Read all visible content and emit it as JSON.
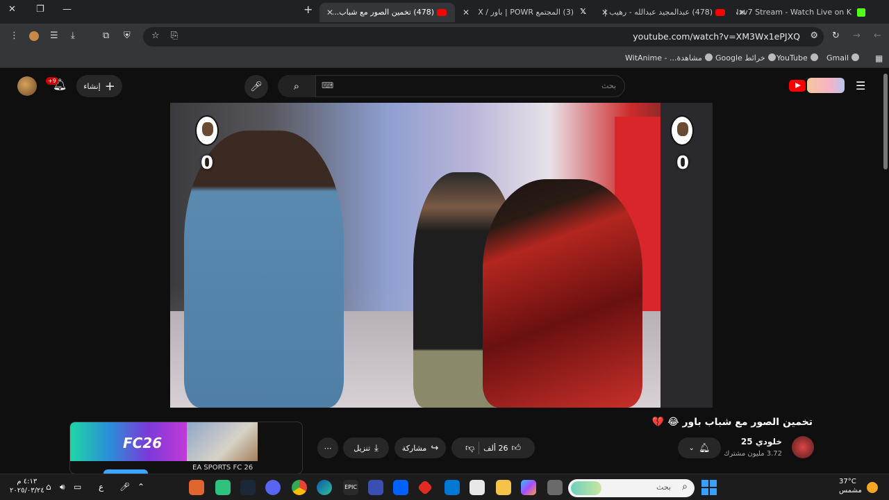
{
  "browser": {
    "tabs": [
      {
        "title": "(478) تخمين الصور مع شباب...",
        "active": true
      },
      {
        "title": "(3) المجتمع POWR | باور / X",
        "active": false
      },
      {
        "title": "(478) عبدالمجيد عبدالله - رهيب |",
        "active": false
      },
      {
        "title": "Nxv7 Stream - Watch Live on K",
        "active": false
      }
    ],
    "url": "youtube.com/watch?v=XM3Wx1ePJXQ",
    "bookmarks": [
      "Gmail",
      "YouTube",
      "خرائط Google",
      "مشاهدة... - WitAnime"
    ]
  },
  "youtube": {
    "search_placeholder": "بحث",
    "create_label": "إنشاء",
    "notification_count": "+9",
    "video": {
      "score_left": "0",
      "score_right": "0"
    },
    "title": "تخمين الصور مع شباب باور 😂 💔",
    "channel": {
      "name": "خلودي 25",
      "subscribers": "3.72 مليون مشترك"
    },
    "actions": {
      "likes": "26 ألف",
      "share": "مشاركة",
      "download": "تنزيل",
      "more": "⋯"
    },
    "ad": {
      "brand": "FC26",
      "text": "EA SPORTS FC 26"
    }
  },
  "taskbar": {
    "search_placeholder": "بحث",
    "weather_temp": "37°C",
    "weather_label": "مشمس",
    "time": "٤:١٣ م",
    "date": "٢٠٢٥/٠٣/٢٤",
    "lang": "ع"
  }
}
